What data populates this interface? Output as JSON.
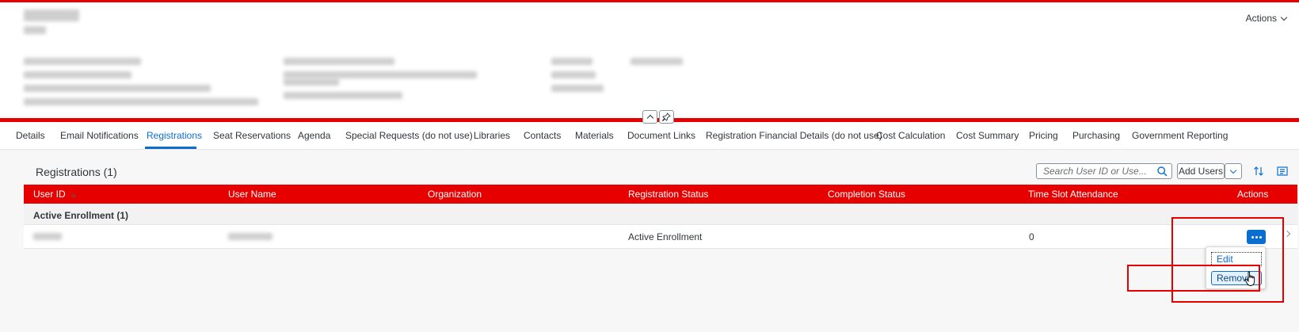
{
  "header": {
    "actions_label": "Actions"
  },
  "tabs": [
    {
      "label": "Details"
    },
    {
      "label": "Email Notifications"
    },
    {
      "label": "Registrations"
    },
    {
      "label": "Seat Reservations"
    },
    {
      "label": "Agenda"
    },
    {
      "label": "Special Requests (do not use)"
    },
    {
      "label": "Libraries"
    },
    {
      "label": "Contacts"
    },
    {
      "label": "Materials"
    },
    {
      "label": "Document Links"
    },
    {
      "label": "Registration Financial Details (do not use)"
    },
    {
      "label": "Cost Calculation"
    },
    {
      "label": "Cost Summary"
    },
    {
      "label": "Pricing"
    },
    {
      "label": "Purchasing"
    },
    {
      "label": "Government Reporting"
    }
  ],
  "active_tab": "Registrations",
  "registrations": {
    "title": "Registrations (1)",
    "search_placeholder": "Search User ID or Use...",
    "add_users_label": "Add Users",
    "columns": [
      "User ID",
      "User Name",
      "Organization",
      "Registration Status",
      "Completion Status",
      "Time Slot Attendance",
      "Actions"
    ],
    "group_label": "Active Enrollment (1)",
    "rows": [
      {
        "registration_status": "Active Enrollment",
        "time_slot_attendance": "0"
      }
    ]
  },
  "row_menu": {
    "edit_label": "Edit",
    "remove_label": "Remove"
  },
  "colors": {
    "brand_red": "#e60000",
    "accent_blue": "#0a6ed1"
  },
  "icons": [
    "chevron-down-icon",
    "collapse-header-icon",
    "pin-icon",
    "search-icon",
    "sort-icon",
    "settings-icon",
    "more-icon",
    "navigation-arrow-icon",
    "hand-cursor-icon"
  ]
}
